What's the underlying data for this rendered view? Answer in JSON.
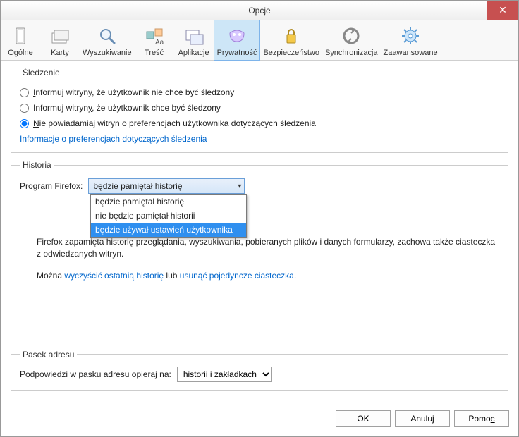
{
  "window": {
    "title": "Opcje"
  },
  "tabs": [
    {
      "label": "Ogólne"
    },
    {
      "label": "Karty"
    },
    {
      "label": "Wyszukiwanie"
    },
    {
      "label": "Treść"
    },
    {
      "label": "Aplikacje"
    },
    {
      "label": "Prywatność"
    },
    {
      "label": "Bezpieczeństwo"
    },
    {
      "label": "Synchronizacja"
    },
    {
      "label": "Zaawansowane"
    }
  ],
  "tracking": {
    "legend": "Śledzenie",
    "opt1_pre": "",
    "opt1_u": "I",
    "opt1_post": "nformuj witryny, że użytkownik nie chce być śledzony",
    "opt2_pre": "Informuj witryn",
    "opt2_u": "y",
    "opt2_post": ", że użytkownik chce być śledzony",
    "opt3_pre": "",
    "opt3_u": "N",
    "opt3_post": "ie powiadamiaj witryn o preferencjach użytkownika dotyczących śledzenia",
    "more_link": "Informacje o preferencjach dotyczących śledzenia"
  },
  "history": {
    "legend": "Historia",
    "program_label_pre": "Progra",
    "program_label_u": "m",
    "program_label_post": " Firefox:",
    "combo_selected": "będzie pamiętał historię",
    "options": [
      "będzie pamiętał historię",
      "nie będzie pamiętał historii",
      "będzie używał ustawień użytkownika"
    ],
    "desc": "Firefox zapamięta historię przeglądania, wyszukiwania, pobieranych plików i danych formularzy, zachowa także ciasteczka z odwiedzanych witryn.",
    "links_pre": "Można ",
    "link1": "wyczyścić ostatnią historię",
    "links_mid": " lub ",
    "link2": "usunąć pojedyncze ciasteczka",
    "links_end": "."
  },
  "addressbar": {
    "legend": "Pasek adresu",
    "label_pre": "Podpowiedzi w pask",
    "label_u": "u",
    "label_post": " adresu opieraj na:",
    "selected": "historii i zakładkach"
  },
  "buttons": {
    "ok": "OK",
    "cancel": "Anuluj",
    "help_pre": "Pomo",
    "help_u": "c"
  }
}
